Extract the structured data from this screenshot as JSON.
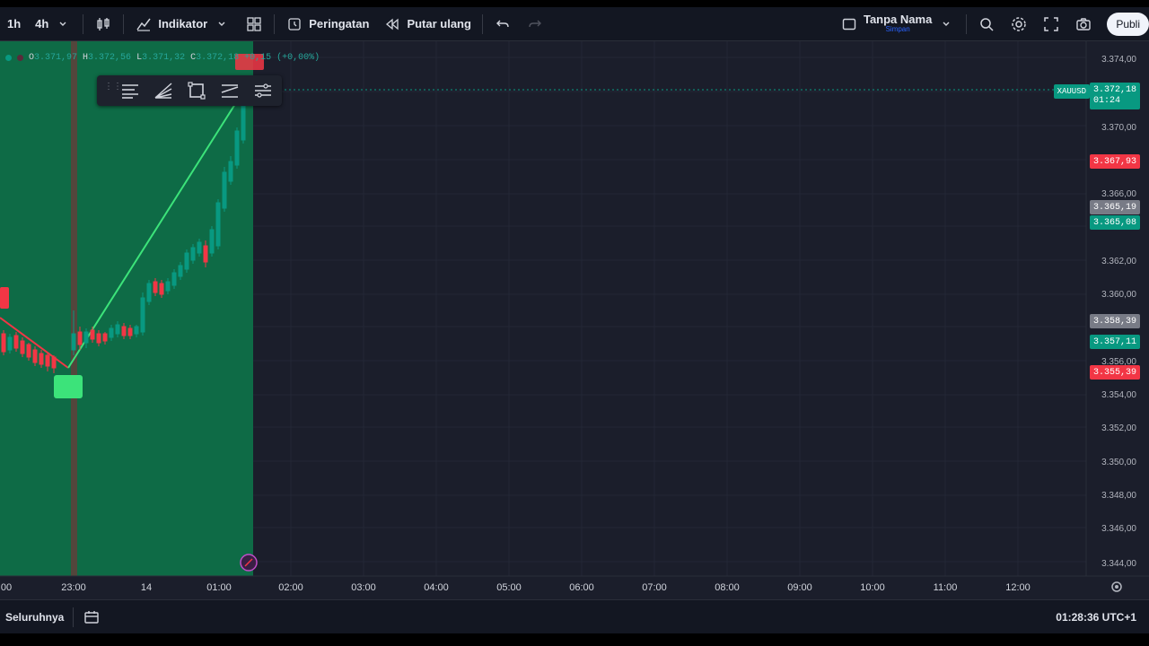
{
  "toolbar": {
    "interval_1h": "1h",
    "interval_4h": "4h",
    "indicators_label": "Indikator",
    "alerts_label": "Peringatan",
    "replay_label": "Putar ulang",
    "layout_name": "Tanpa Nama",
    "layout_status": "Simpan",
    "publish_label": "Publi"
  },
  "ohlc": {
    "open_label": "O",
    "open": "3.371,97",
    "high_label": "H",
    "high": "3.372,56",
    "low_label": "L",
    "low": "3.371,32",
    "close_label": "C",
    "close": "3.372,18",
    "change": "+0,15 (+0,00%)"
  },
  "price_scale": {
    "ticks": [
      "3.374,00",
      "3.370,00",
      "3.366,00",
      "3.362,00",
      "3.360,00",
      "3.356,00",
      "3.354,00",
      "3.352,00",
      "3.350,00",
      "3.348,00",
      "3.346,00",
      "3.344,00"
    ],
    "symbol": "XAUUSD",
    "last_price": "3.372,18",
    "countdown": "01:24",
    "tags": [
      {
        "text": "3.367,93",
        "color": "#f23645"
      },
      {
        "text": "3.365,19",
        "color": "#787b86"
      },
      {
        "text": "3.365,08",
        "color": "#089981"
      },
      {
        "text": "3.358,39",
        "color": "#787b86"
      },
      {
        "text": "3.357,11",
        "color": "#089981"
      },
      {
        "text": "3.355,39",
        "color": "#f23645"
      }
    ]
  },
  "time_scale": {
    "ticks": [
      "00",
      "23:00",
      "14",
      "01:00",
      "02:00",
      "03:00",
      "04:00",
      "05:00",
      "06:00",
      "07:00",
      "08:00",
      "09:00",
      "10:00",
      "11:00",
      "12:00"
    ]
  },
  "bottombar": {
    "range_label": "Seluruhnya",
    "clock": "01:28:36 UTC+1"
  },
  "colors": {
    "bull": "#089981",
    "bear": "#f23645",
    "zone": "#0e6b46",
    "trend_line": "#3ce37a"
  }
}
